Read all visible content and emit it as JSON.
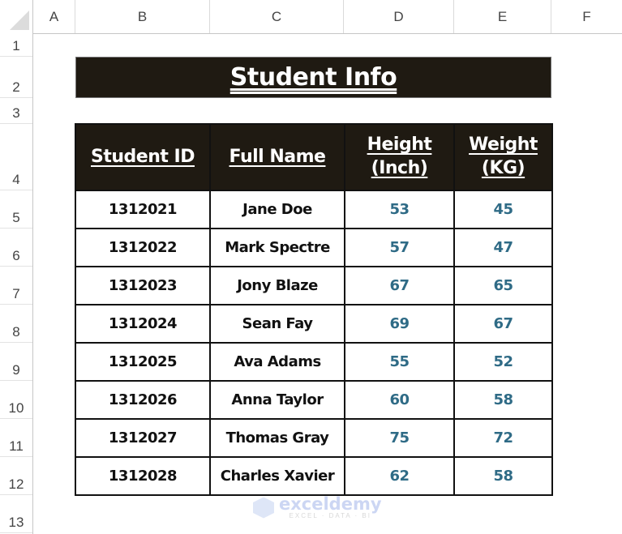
{
  "spreadsheet": {
    "columns": [
      "A",
      "B",
      "C",
      "D",
      "E",
      "F"
    ],
    "rows": [
      "1",
      "2",
      "3",
      "4",
      "5",
      "6",
      "7",
      "8",
      "9",
      "10",
      "11",
      "12",
      "13"
    ]
  },
  "title": "Student Info",
  "table": {
    "headers": [
      "Student ID",
      "Full Name",
      "Height (Inch)",
      "Weight (KG)"
    ],
    "header_lines": {
      "height": [
        "Height",
        "(Inch)"
      ],
      "weight": [
        "Weight",
        "(KG)"
      ]
    },
    "rows": [
      {
        "id": "1312021",
        "name": "Jane Doe",
        "height": "53",
        "weight": "45"
      },
      {
        "id": "1312022",
        "name": "Mark Spectre",
        "height": "57",
        "weight": "47"
      },
      {
        "id": "1312023",
        "name": "Jony Blaze",
        "height": "67",
        "weight": "65"
      },
      {
        "id": "1312024",
        "name": "Sean Fay",
        "height": "69",
        "weight": "67"
      },
      {
        "id": "1312025",
        "name": "Ava Adams",
        "height": "55",
        "weight": "52"
      },
      {
        "id": "1312026",
        "name": "Anna Taylor",
        "height": "60",
        "weight": "58"
      },
      {
        "id": "1312027",
        "name": "Thomas Gray",
        "height": "75",
        "weight": "72"
      },
      {
        "id": "1312028",
        "name": "Charles Xavier",
        "height": "62",
        "weight": "58"
      }
    ]
  },
  "watermark": {
    "brand": "exceldemy",
    "tagline": "EXCEL · DATA · BI"
  },
  "colors": {
    "header_bg": "#1f1a12",
    "header_text": "#ffffff",
    "numeric_text": "#2f6b86"
  }
}
